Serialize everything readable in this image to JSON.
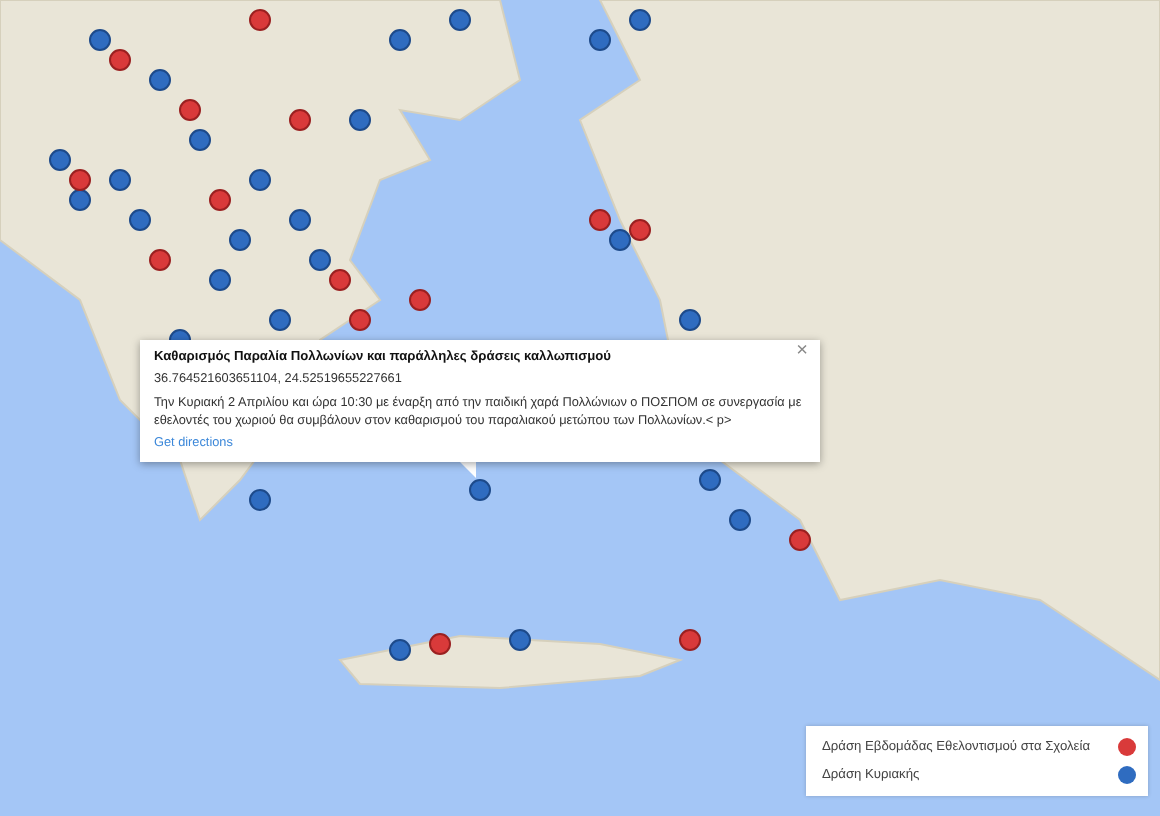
{
  "info_window": {
    "title": "Καθαρισμός Παραλία Πολλωνίων και παράλληλες δράσεις καλλωπισμού",
    "coordinates": "36.764521603651104, 24.52519655227661",
    "description": "Την Κυριακή 2 Απριλίου και ώρα 10:30 με έναρξη από την παιδική χαρά Πολλώνιων ο ΠΟΣΠΟΜ σε συνεργασία με εθελοντές του χωριού θα συμβάλουν στον καθαρισμού του παραλιακού μετώπου των Πολλωνίων.< p>",
    "link": "Get directions",
    "close": "×"
  },
  "legend": [
    {
      "label": "Δράση Εβδομάδας Εθελοντισμού στα Σχολεία",
      "color": "#d93a3a"
    },
    {
      "label": "Δράση Κυριακής",
      "color": "#2f6cc0"
    }
  ]
}
